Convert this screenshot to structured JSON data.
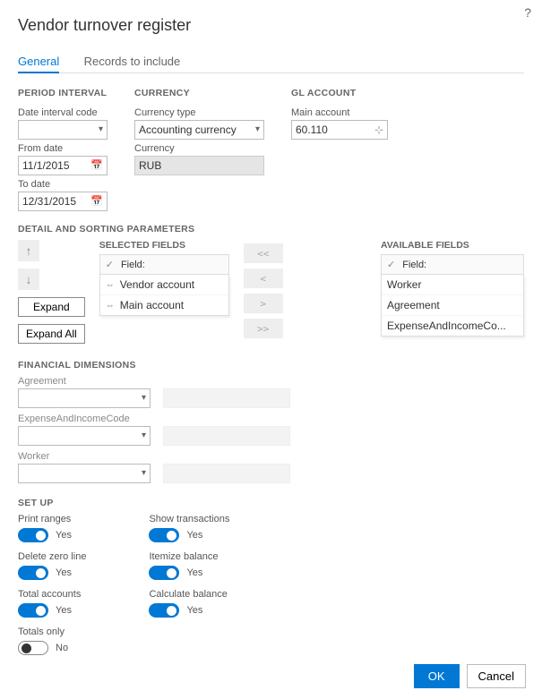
{
  "header": {
    "title": "Vendor turnover register"
  },
  "tabs": {
    "general": "General",
    "records": "Records to include"
  },
  "period_interval": {
    "heading": "PERIOD INTERVAL",
    "date_interval_code_label": "Date interval code",
    "date_interval_code_value": "",
    "from_date_label": "From date",
    "from_date_value": "11/1/2015",
    "to_date_label": "To date",
    "to_date_value": "12/31/2015"
  },
  "currency": {
    "heading": "CURRENCY",
    "type_label": "Currency type",
    "type_value": "Accounting currency",
    "currency_label": "Currency",
    "currency_value": "RUB"
  },
  "gl_account": {
    "heading": "GL ACCOUNT",
    "main_account_label": "Main account",
    "main_account_value": "60.110"
  },
  "detail": {
    "heading": "DETAIL AND SORTING PARAMETERS",
    "selected_label": "SELECTED FIELDS",
    "field_header": "Field:",
    "selected_items": [
      "Vendor account",
      "Main account"
    ],
    "expand": "Expand",
    "expand_all": "Expand All",
    "move": {
      "all_left": "<<",
      "left": "<",
      "right": ">",
      "all_right": ">>"
    },
    "available_label": "AVAILABLE FIELDS",
    "available_field_header": "Field:",
    "available_items": [
      "Worker",
      "Agreement",
      "ExpenseAndIncomeCo..."
    ]
  },
  "financial_dimensions": {
    "heading": "FINANCIAL DIMENSIONS",
    "agreement_label": "Agreement",
    "expense_label": "ExpenseAndIncomeCode",
    "worker_label": "Worker"
  },
  "setup": {
    "heading": "SET UP",
    "left": [
      {
        "label": "Print ranges",
        "value": "Yes",
        "on": true
      },
      {
        "label": "Delete zero line",
        "value": "Yes",
        "on": true
      },
      {
        "label": "Total accounts",
        "value": "Yes",
        "on": true
      },
      {
        "label": "Totals only",
        "value": "No",
        "on": false
      }
    ],
    "right": [
      {
        "label": "Show transactions",
        "value": "Yes",
        "on": true
      },
      {
        "label": "Itemize balance",
        "value": "Yes",
        "on": true
      },
      {
        "label": "Calculate balance",
        "value": "Yes",
        "on": true
      }
    ]
  },
  "footer": {
    "ok": "OK",
    "cancel": "Cancel"
  }
}
